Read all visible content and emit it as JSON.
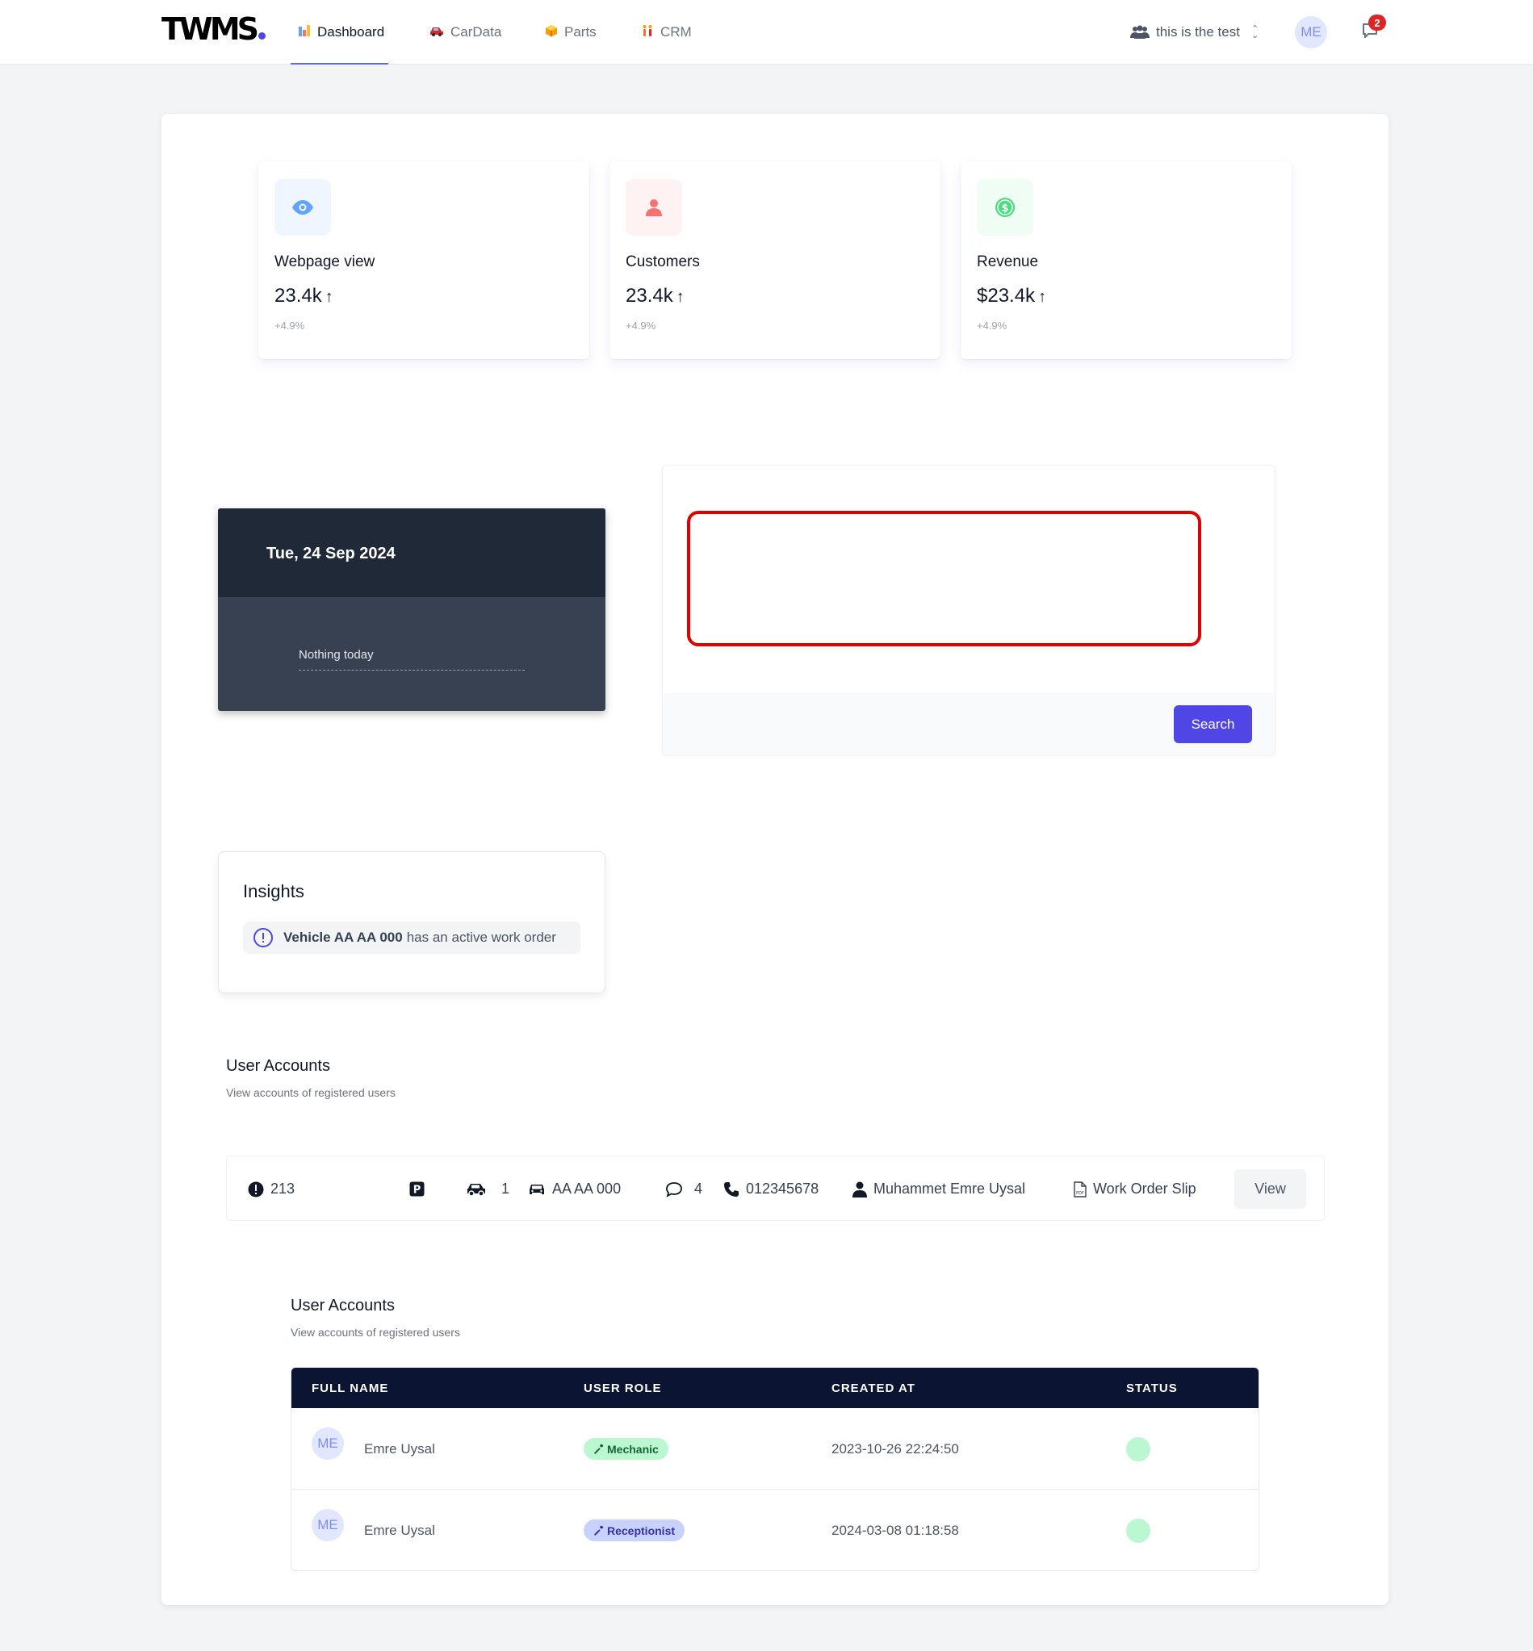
{
  "app": {
    "logo_text": "TWMS",
    "accent_color": "#4f46e5"
  },
  "nav": {
    "tabs": [
      {
        "label": "Dashboard",
        "icon": "bar-chart-icon",
        "active": true
      },
      {
        "label": "CarData",
        "icon": "car-icon",
        "active": false
      },
      {
        "label": "Parts",
        "icon": "package-icon",
        "active": false
      },
      {
        "label": "CRM",
        "icon": "people-icon",
        "active": false
      }
    ],
    "team_name": "this is the test",
    "user_initials": "ME",
    "notification_count": "2"
  },
  "stats": [
    {
      "label": "Webpage view",
      "value": "23.4k",
      "change": "+4.9%",
      "icon": "eye-icon",
      "color": "#60a5fa"
    },
    {
      "label": "Customers",
      "value": "23.4k",
      "change": "+4.9%",
      "icon": "user-icon",
      "color": "#f87171"
    },
    {
      "label": "Revenue",
      "value": "$23.4k",
      "change": "+4.9%",
      "icon": "dollar-icon",
      "color": "#4ade80"
    }
  ],
  "calendar": {
    "date": "Tue, 24 Sep 2024",
    "empty_text": "Nothing today"
  },
  "search": {
    "value": "",
    "button_label": "Search"
  },
  "insights": {
    "title": "Insights",
    "item": {
      "vehicle": "Vehicle AA AA 000",
      "message": "has an active work order"
    }
  },
  "work_orders": {
    "title": "User Accounts",
    "subtitle": "View accounts of registered users",
    "row": {
      "id": "213",
      "vehicle_count": "1",
      "plate": "AA AA 000",
      "comments": "4",
      "phone": "012345678",
      "customer": "Muhammet Emre Uysal",
      "document": "Work Order Slip",
      "view_label": "View"
    }
  },
  "users": {
    "title": "User Accounts",
    "subtitle": "View accounts of registered users",
    "columns": [
      "FULL NAME",
      "USER ROLE",
      "CREATED AT",
      "STATUS"
    ],
    "rows": [
      {
        "initials": "ME",
        "name": "Emre Uysal",
        "role": "Mechanic",
        "role_color": "#bbf7d0",
        "role_text_color": "#166534",
        "created": "2023-10-26 22:24:50",
        "status_color": "#bbf7d0"
      },
      {
        "initials": "ME",
        "name": "Emre Uysal",
        "role": "Receptionist",
        "role_color": "#c7d2fe",
        "role_text_color": "#3730a3",
        "created": "2024-03-08 01:18:58",
        "status_color": "#bbf7d0"
      }
    ]
  }
}
